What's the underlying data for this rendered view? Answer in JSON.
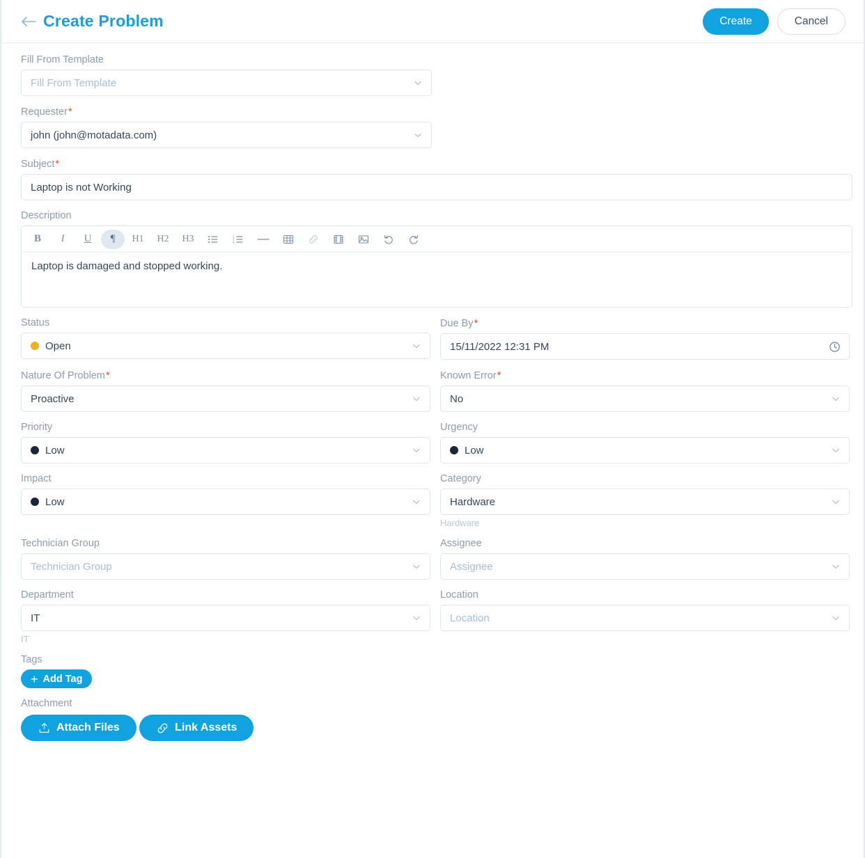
{
  "header": {
    "back_icon": "arrow-left-icon",
    "title": "Create Problem",
    "create_label": "Create",
    "cancel_label": "Cancel",
    "accent_color": "#11a2e0"
  },
  "form": {
    "fill_from_template": {
      "label": "Fill From Template",
      "value": "",
      "placeholder": "Fill From Template"
    },
    "requester": {
      "label": "Requester",
      "required": "*",
      "value": "john (john@motadata.com)"
    },
    "subject": {
      "label": "Subject",
      "required": "*",
      "value": "Laptop is not Working"
    },
    "description": {
      "label": "Description",
      "value": "Laptop is damaged and stopped working.",
      "toolbar": [
        {
          "name": "bold-icon",
          "glyph": "B"
        },
        {
          "name": "italic-icon",
          "glyph": "I"
        },
        {
          "name": "underline-icon",
          "glyph": "U"
        },
        {
          "name": "paragraph-icon",
          "glyph": "¶"
        },
        {
          "name": "heading-1-icon",
          "glyph": "H1"
        },
        {
          "name": "heading-2-icon",
          "glyph": "H2"
        },
        {
          "name": "heading-3-icon",
          "glyph": "H3"
        },
        {
          "name": "bullet-list-icon",
          "glyph": ""
        },
        {
          "name": "ordered-list-icon",
          "glyph": ""
        },
        {
          "name": "horizontal-rule-icon",
          "glyph": ""
        },
        {
          "name": "table-icon",
          "glyph": ""
        },
        {
          "name": "link-icon",
          "glyph": ""
        },
        {
          "name": "video-icon",
          "glyph": ""
        },
        {
          "name": "image-icon",
          "glyph": ""
        },
        {
          "name": "undo-icon",
          "glyph": ""
        },
        {
          "name": "redo-icon",
          "glyph": ""
        }
      ]
    },
    "status": {
      "label": "Status",
      "value": "Open",
      "dot_color": "#efb020"
    },
    "due_by": {
      "label": "Due By",
      "required": "*",
      "value": "15/11/2022 12:31 PM",
      "icon": "clock-icon"
    },
    "nature_of_problem": {
      "label": "Nature Of Problem",
      "required": "*",
      "value": "Proactive"
    },
    "known_error": {
      "label": "Known Error",
      "required": "*",
      "value": "No"
    },
    "priority": {
      "label": "Priority",
      "value": "Low",
      "dot_color": "#1b2738"
    },
    "urgency": {
      "label": "Urgency",
      "value": "Low",
      "dot_color": "#1b2738"
    },
    "impact": {
      "label": "Impact",
      "value": "Low",
      "dot_color": "#1b2738"
    },
    "category": {
      "label": "Category",
      "value": "Hardware",
      "helper": "Hardware"
    },
    "technician_group": {
      "label": "Technician Group",
      "value": "",
      "placeholder": "Technician Group"
    },
    "assignee": {
      "label": "Assignee",
      "value": "",
      "placeholder": "Assignee"
    },
    "department": {
      "label": "Department",
      "value": "IT",
      "helper": "IT"
    },
    "location": {
      "label": "Location",
      "value": "",
      "placeholder": "Location"
    },
    "tags": {
      "label": "Tags",
      "add_label": "Add Tag",
      "plus": "+"
    },
    "attachment": {
      "label": "Attachment",
      "attach_files_label": "Attach Files",
      "link_assets_label": "Link Assets"
    }
  }
}
